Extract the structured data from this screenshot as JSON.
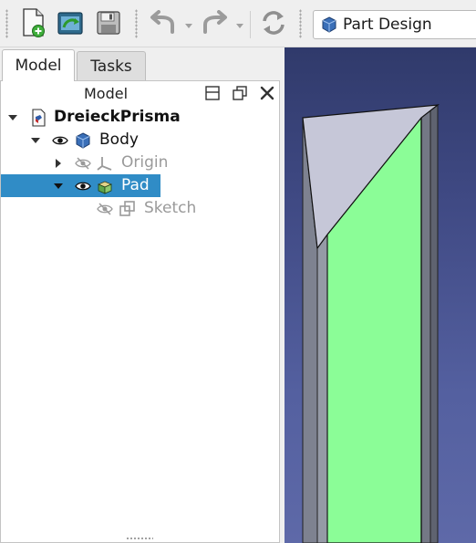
{
  "toolbar": {
    "buttons": [
      {
        "name": "new-document",
        "icon": "new-document-icon"
      },
      {
        "name": "open-document",
        "icon": "open-folder-icon"
      },
      {
        "name": "save-document",
        "icon": "save-icon"
      },
      {
        "name": "undo",
        "icon": "undo-icon"
      },
      {
        "name": "redo",
        "icon": "redo-icon"
      },
      {
        "name": "refresh",
        "icon": "refresh-icon"
      }
    ],
    "workbench": {
      "label": "Part Design",
      "icon": "part-design-icon"
    }
  },
  "panel": {
    "tabs": [
      {
        "label": "Model",
        "active": true
      },
      {
        "label": "Tasks",
        "active": false
      }
    ],
    "tree_title": "Model",
    "tree": [
      {
        "label": "DreieckPrisma",
        "level": 0,
        "expanded": true,
        "bold": true,
        "visible_icon": false,
        "type_icon": "document-icon",
        "state": "normal"
      },
      {
        "label": "Body",
        "level": 1,
        "expanded": true,
        "bold": false,
        "visible_icon": "eye-icon",
        "type_icon": "body-icon",
        "state": "normal"
      },
      {
        "label": "Origin",
        "level": 2,
        "expanded": false,
        "bold": false,
        "visible_icon": "eye-hidden-icon",
        "type_icon": "origin-axes-icon",
        "state": "dimmed"
      },
      {
        "label": "Pad",
        "level": 2,
        "expanded": true,
        "bold": false,
        "visible_icon": "eye-icon",
        "type_icon": "pad-icon",
        "state": "selected"
      },
      {
        "label": "Sketch",
        "level": 3,
        "expanded": null,
        "bold": false,
        "visible_icon": "eye-hidden-icon",
        "type_icon": "sketch-icon",
        "state": "dimmed"
      }
    ]
  },
  "colors": {
    "selection": "#308cc6",
    "pad_face": "#8bfd97",
    "top_face": "#c6c7d8",
    "side_face": "#8a8e99",
    "view_bg_top": "#303a6b",
    "view_bg_bottom": "#5e69a8"
  }
}
